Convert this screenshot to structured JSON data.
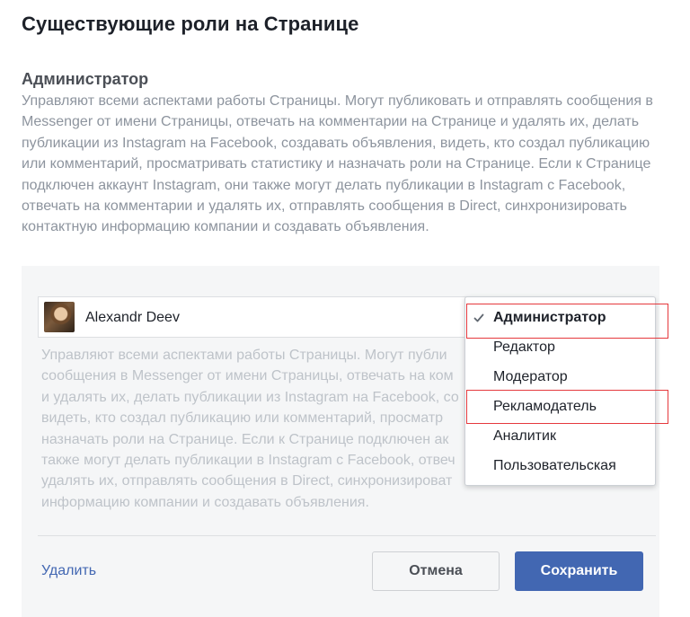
{
  "page": {
    "title": "Существующие роли на Странице"
  },
  "role": {
    "heading": "Администратор",
    "description": "Управляют всеми аспектами работы Страницы. Могут публиковать и отправлять сообщения в Messenger от имени Страницы, отвечать на комментарии на Странице и удалять их, делать публикации из Instagram на Facebook, создавать объявления, видеть, кто создал публикацию или комментарий, просматривать статистику и назначать роли на Странице. Если к Странице подключен аккаунт Instagram, они также могут делать публикации в Instagram с Facebook, отвечать на комментарии и удалять их, отправлять сообщения в Direct, синхронизировать контактную информацию компании и создавать объявления."
  },
  "card": {
    "user_name": "Alexandr Deev",
    "avatar_icon": "user-avatar-photo",
    "description_lines": [
      "Управляют всеми аспектами работы Страницы. Могут публи",
      "сообщения в Messenger от имени Страницы, отвечать на ком",
      "и удалять их, делать публикации из Instagram на Facebook, со",
      "видеть, кто создал публикацию или комментарий, просматр",
      "назначать роли на Странице. Если к Странице подключен ак",
      "также могут делать публикации в Instagram с Facebook, отвеч",
      "удалять их, отправлять сообщения в Direct, синхронизироват",
      "информацию компании и создавать объявления."
    ]
  },
  "dropdown": {
    "check_icon": "check-icon",
    "options": [
      {
        "label": "Администратор",
        "selected": true,
        "highlighted": true
      },
      {
        "label": "Редактор",
        "selected": false,
        "highlighted": false
      },
      {
        "label": "Модератор",
        "selected": false,
        "highlighted": false
      },
      {
        "label": "Рекламодатель",
        "selected": false,
        "highlighted": true
      },
      {
        "label": "Аналитик",
        "selected": false,
        "highlighted": false
      },
      {
        "label": "Пользовательская",
        "selected": false,
        "highlighted": false
      }
    ]
  },
  "actions": {
    "delete_label": "Удалить",
    "cancel_label": "Отмена",
    "save_label": "Сохранить"
  },
  "colors": {
    "accent": "#4267b2",
    "highlight": "#e5393d"
  }
}
